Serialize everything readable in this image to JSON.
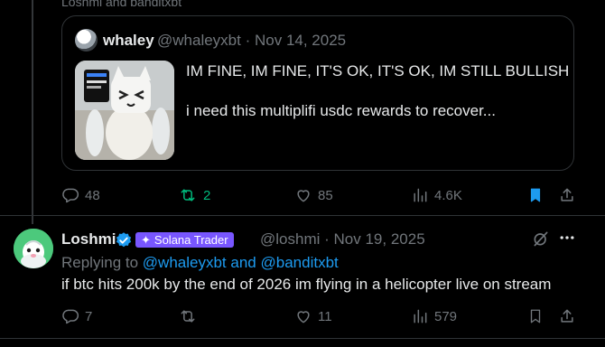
{
  "context_line": "Loshmi and banditxbt",
  "quoted_tweet": {
    "name": "whaley",
    "handle": "@whaleyxbt",
    "date": "Nov 14, 2025",
    "line1": "IM FINE, IM FINE, IT'S OK, IT'S OK, IM STILL BULLISH",
    "line2": "i need this multiplifi usdc rewards to recover..."
  },
  "parent_actions": {
    "replies": "48",
    "reposts": "2",
    "likes": "85",
    "views": "4.6K"
  },
  "reply_tweet": {
    "name": "Loshmi",
    "badge": "Solana Trader",
    "handle": "@loshmi",
    "date": "Nov 19, 2025",
    "replying_prefix": "Replying to",
    "reply_user1": "@whaleyxbt",
    "reply_and": "and",
    "reply_user2": "@banditxbt",
    "text": "if btc hits 200k by the end of 2026 im flying in a helicopter live on stream"
  },
  "reply_actions": {
    "replies": "7",
    "reposts": "",
    "likes": "11",
    "views": "579"
  },
  "colors": {
    "accent": "#1d9bf0",
    "repost_active": "#00ba7c",
    "muted": "#71767b",
    "badge": "#7856ff"
  },
  "icons": [
    "reply-icon",
    "repost-icon",
    "like-icon",
    "views-icon",
    "bookmark-icon",
    "share-icon",
    "verified-icon",
    "grok-icon",
    "more-icon"
  ]
}
